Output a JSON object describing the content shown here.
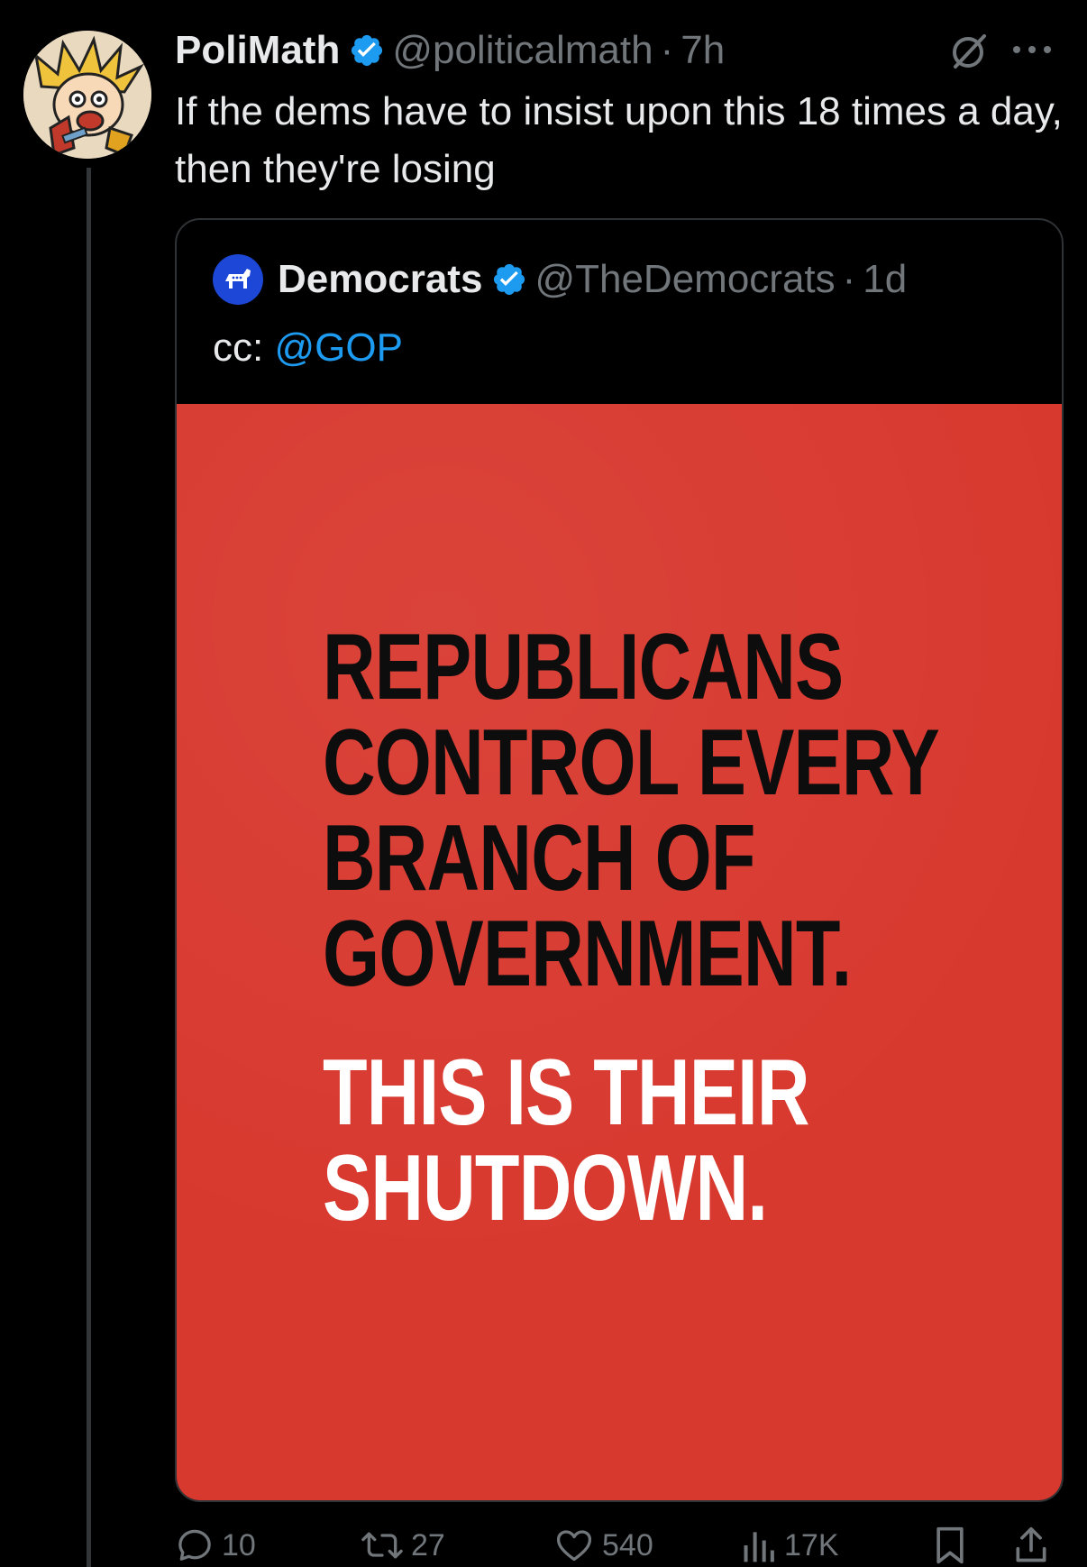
{
  "post": {
    "author": {
      "display_name": "PoliMath",
      "handle": "@politicalmath",
      "separator": "·",
      "time": "7h"
    },
    "text": "If the dems have to insist upon this 18 times a day, then they're losing"
  },
  "quoted_post": {
    "author": {
      "display_name": "Democrats",
      "handle": "@TheDemocrats",
      "separator": "·",
      "time": "1d"
    },
    "text_prefix": "cc: ",
    "mention": "@GOP",
    "image": {
      "lines_black": [
        "REPUBLICANS",
        "CONTROL EVERY",
        "BRANCH OF",
        "GOVERNMENT."
      ],
      "lines_white": [
        "THIS IS THEIR",
        "SHUTDOWN."
      ]
    }
  },
  "actions": {
    "replies": "10",
    "reposts": "27",
    "likes": "540",
    "views": "17K"
  },
  "colors": {
    "background": "#000000",
    "text_primary": "#e7e9ea",
    "text_secondary": "#71767b",
    "link": "#1d9bf0",
    "verified": "#1d9bf0",
    "poster_red": "#d8392f"
  },
  "icons": {
    "verified": "verified-badge-icon",
    "grok": "grok-icon",
    "more": "more-options-icon",
    "reply": "reply-icon",
    "repost": "repost-icon",
    "like": "heart-icon",
    "views": "views-icon",
    "bookmark": "bookmark-icon",
    "share": "share-icon"
  }
}
